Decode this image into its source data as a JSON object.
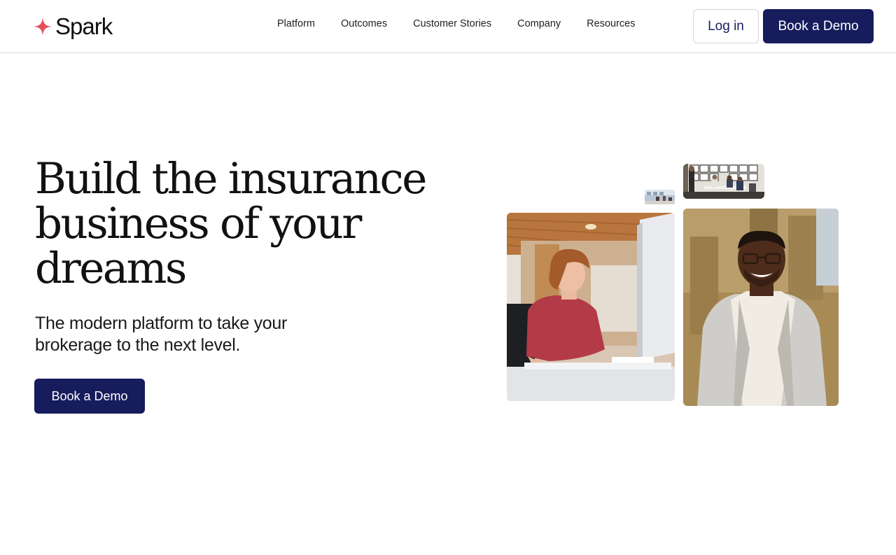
{
  "brand": {
    "name": "Spark",
    "accent_color": "#e2505f",
    "icon": "sparkle-star-icon"
  },
  "nav": {
    "items": [
      {
        "label": "Platform"
      },
      {
        "label": "Outcomes"
      },
      {
        "label": "Customer Stories"
      },
      {
        "label": "Company"
      },
      {
        "label": "Resources"
      }
    ]
  },
  "header": {
    "login_label": "Log in",
    "demo_label": "Book a Demo",
    "primary_color": "#161c5c"
  },
  "hero": {
    "title": "Build the insurance business of your dreams",
    "subtitle": "The modern platform to take your brokerage to the next level.",
    "cta_label": "Book a Demo"
  }
}
